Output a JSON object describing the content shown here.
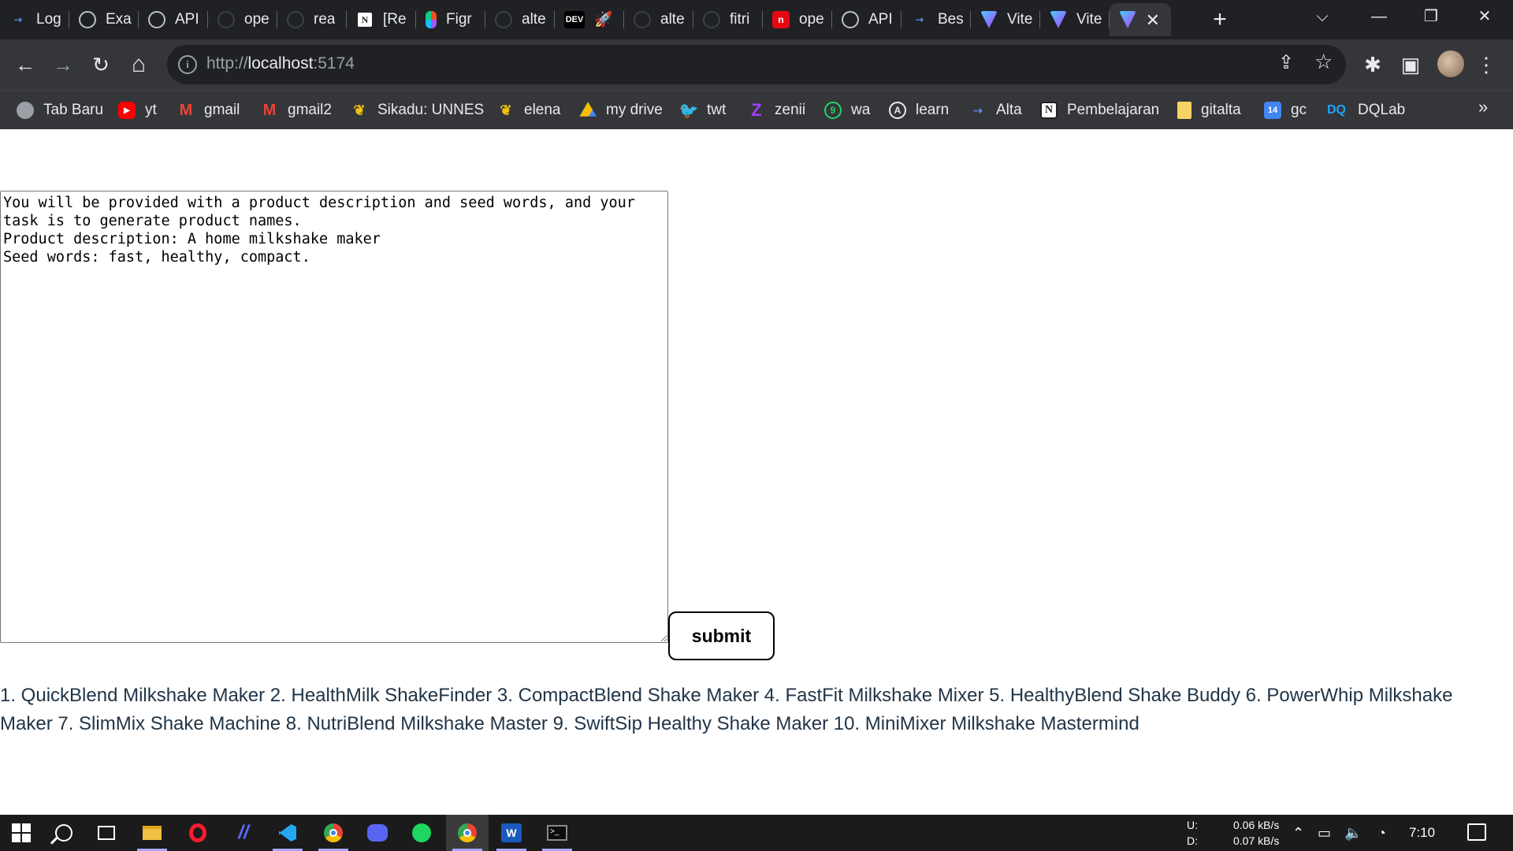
{
  "browser": {
    "tabs": [
      {
        "title": "Log",
        "icon": "git-icon"
      },
      {
        "title": "Exa",
        "icon": "openai-icon"
      },
      {
        "title": "API",
        "icon": "openai-icon"
      },
      {
        "title": "ope",
        "icon": "github-icon"
      },
      {
        "title": "rea",
        "icon": "github-icon"
      },
      {
        "title": "[Re",
        "icon": "notion-icon"
      },
      {
        "title": "Figr",
        "icon": "figma-icon"
      },
      {
        "title": "alte",
        "icon": "github-icon"
      },
      {
        "title": "🚀",
        "icon": "dev-icon"
      },
      {
        "title": "alte",
        "icon": "github-icon"
      },
      {
        "title": "fitri",
        "icon": "github-icon"
      },
      {
        "title": "ope",
        "icon": "red-n-icon"
      },
      {
        "title": "API",
        "icon": "openai-icon"
      },
      {
        "title": "Bes",
        "icon": "git-icon"
      },
      {
        "title": "Vite",
        "icon": "vite-icon"
      },
      {
        "title": "Vite",
        "icon": "vite-icon"
      },
      {
        "title": "",
        "icon": "vite-icon",
        "active": true
      }
    ],
    "dev_badge": "DEV",
    "notion_glyph": "N",
    "red_glyph": "n",
    "close_glyph": "✕",
    "new_tab_glyph": "+",
    "window": {
      "dropdown": "⌵",
      "minimize": "—",
      "restore": "❐",
      "close": "✕"
    },
    "toolbar": {
      "back": "←",
      "forward": "→",
      "reload": "↻",
      "home": "⌂",
      "info_glyph": "i",
      "url_scheme": "http://",
      "url_host": "localhost",
      "url_port": ":5174",
      "share": "⇪",
      "star": "☆",
      "extensions": "✱",
      "sidepanel": "▣",
      "menu": "⋮"
    },
    "bookmarks": [
      {
        "label": "Tab Baru",
        "icon": "tab-baru-icon",
        "glyph": ""
      },
      {
        "label": "yt",
        "icon": "youtube-icon",
        "glyph": "▶"
      },
      {
        "label": "gmail",
        "icon": "gmail-icon",
        "glyph": "M"
      },
      {
        "label": "gmail2",
        "icon": "gmail-icon",
        "glyph": "M"
      },
      {
        "label": "Sikadu: UNNES",
        "icon": "unnes-icon",
        "glyph": "❦"
      },
      {
        "label": "elena",
        "icon": "unnes-icon",
        "glyph": "❦"
      },
      {
        "label": "my drive",
        "icon": "drive-icon",
        "glyph": ""
      },
      {
        "label": "twt",
        "icon": "twitter-icon",
        "glyph": "🐦"
      },
      {
        "label": "zenii",
        "icon": "zenii-icon",
        "glyph": "Z"
      },
      {
        "label": "wa",
        "icon": "whatsapp-icon",
        "glyph": "9"
      },
      {
        "label": "learn",
        "icon": "learn-icon",
        "glyph": "A"
      },
      {
        "label": "Alta",
        "icon": "alta-icon",
        "glyph": "⇢"
      },
      {
        "label": "Pembelajaran",
        "icon": "notion-icon",
        "glyph": "N"
      },
      {
        "label": "gitalta",
        "icon": "folder-icon",
        "glyph": ""
      },
      {
        "label": "gc",
        "icon": "calendar-icon",
        "glyph": "14"
      },
      {
        "label": "DQLab",
        "icon": "dqlab-icon",
        "glyph": "DQ"
      }
    ],
    "bookmarks_more": "»"
  },
  "page": {
    "prompt_text": "You will be provided with a product description and seed words, and your task is to generate product names.\nProduct description: A home milkshake maker\nSeed words: fast, healthy, compact.",
    "submit_label": "submit",
    "result_text": "1. QuickBlend Milkshake Maker 2. HealthMilk ShakeFinder 3. CompactBlend Shake Maker 4. FastFit Milkshake Mixer 5. HealthyBlend Shake Buddy 6. PowerWhip Milkshake Maker 7. SlimMix Shake Machine 8. NutriBlend Milkshake Master 9. SwiftSip Healthy Shake Maker 10. MiniMixer Milkshake Mastermind"
  },
  "taskbar": {
    "apps": [
      "start-icon",
      "search-icon",
      "task-view-icon",
      "file-explorer-icon",
      "opera-icon",
      "slash-app-icon",
      "vscode-icon",
      "chrome-icon",
      "discord-icon",
      "spotify-icon",
      "chrome-icon",
      "word-icon",
      "terminal-icon"
    ],
    "word_glyph": "W",
    "terminal_glyph": ">_",
    "net_up_label": "U:",
    "net_down_label": "D:",
    "net_up_value": "0.06 kB/s",
    "net_down_value": "0.07 kB/s",
    "tray_chevron": "⌃",
    "tray_battery": "▭",
    "tray_volume": "🔈",
    "tray_wifi": "◔",
    "clock": "7:10"
  },
  "colors": {
    "tab_strip": "#202124",
    "toolbar": "#35363a",
    "result_text": "#213547",
    "taskbar": "#1b1b1b"
  }
}
